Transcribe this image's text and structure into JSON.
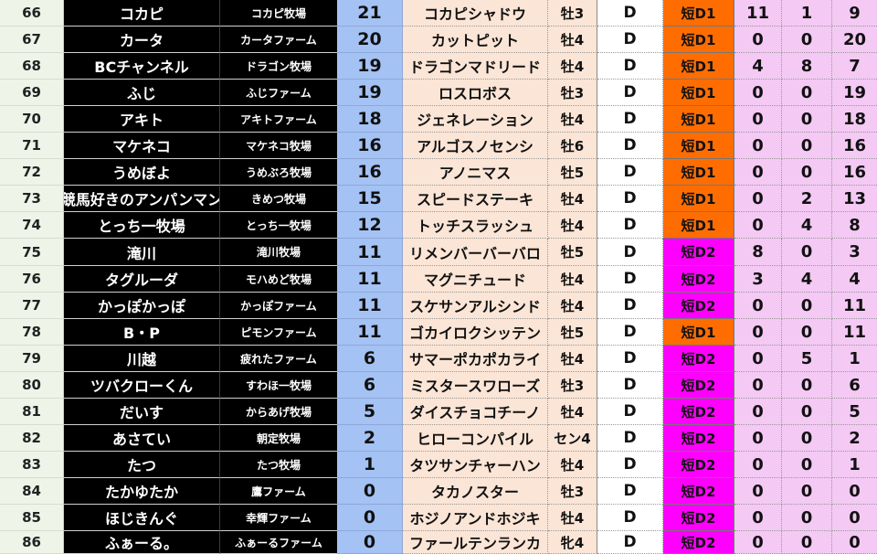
{
  "colors": {
    "row_number_bg": "#eef4e8",
    "name_bg": "#000000",
    "points_bg": "#a4c2f4",
    "horse_bg": "#fbe5d6",
    "division_d1": "#ff6d01",
    "division_d2": "#ff00ff",
    "stats_bg": "#f4c9f4"
  },
  "rows": [
    {
      "num": "66",
      "owner": "コカピ",
      "farm": "コカピ牧場",
      "points": "21",
      "horse": "コカピシャドウ",
      "sex": "牡3",
      "grade": "D",
      "division": "短D1",
      "stat1": "11",
      "stat2": "1",
      "stat3": "9"
    },
    {
      "num": "67",
      "owner": "カータ",
      "farm": "カータファーム",
      "points": "20",
      "horse": "カットピット",
      "sex": "牡4",
      "grade": "D",
      "division": "短D1",
      "stat1": "0",
      "stat2": "0",
      "stat3": "20"
    },
    {
      "num": "68",
      "owner": "BCチャンネル",
      "farm": "ドラゴン牧場",
      "points": "19",
      "horse": "ドラゴンマドリード",
      "sex": "牡4",
      "grade": "D",
      "division": "短D1",
      "stat1": "4",
      "stat2": "8",
      "stat3": "7"
    },
    {
      "num": "69",
      "owner": "ふじ",
      "farm": "ふじファーム",
      "points": "19",
      "horse": "ロスロボス",
      "sex": "牡3",
      "grade": "D",
      "division": "短D1",
      "stat1": "0",
      "stat2": "0",
      "stat3": "19"
    },
    {
      "num": "70",
      "owner": "アキト",
      "farm": "アキトファーム",
      "points": "18",
      "horse": "ジェネレーション",
      "sex": "牡4",
      "grade": "D",
      "division": "短D1",
      "stat1": "0",
      "stat2": "0",
      "stat3": "18"
    },
    {
      "num": "71",
      "owner": "マケネコ",
      "farm": "マケネコ牧場",
      "points": "16",
      "horse": "アルゴスノセンシ",
      "sex": "牡6",
      "grade": "D",
      "division": "短D1",
      "stat1": "0",
      "stat2": "0",
      "stat3": "16"
    },
    {
      "num": "72",
      "owner": "うめぼよ",
      "farm": "うめぶろ牧場",
      "points": "16",
      "horse": "アノニマス",
      "sex": "牡5",
      "grade": "D",
      "division": "短D1",
      "stat1": "0",
      "stat2": "0",
      "stat3": "16"
    },
    {
      "num": "73",
      "owner": "競馬好きのアンパンマン",
      "farm": "きめつ牧場",
      "points": "15",
      "horse": "スピードステーキ",
      "sex": "牡4",
      "grade": "D",
      "division": "短D1",
      "stat1": "0",
      "stat2": "2",
      "stat3": "13"
    },
    {
      "num": "74",
      "owner": "とっち一牧場",
      "farm": "とっち一牧場",
      "points": "12",
      "horse": "トッチスラッシュ",
      "sex": "牡4",
      "grade": "D",
      "division": "短D1",
      "stat1": "0",
      "stat2": "4",
      "stat3": "8"
    },
    {
      "num": "75",
      "owner": "滝川",
      "farm": "滝川牧場",
      "points": "11",
      "horse": "リメンバーバーバロ",
      "sex": "牡5",
      "grade": "D",
      "division": "短D2",
      "stat1": "8",
      "stat2": "0",
      "stat3": "3"
    },
    {
      "num": "76",
      "owner": "タグルーダ",
      "farm": "モハめど牧場",
      "points": "11",
      "horse": "マグニチュード",
      "sex": "牡4",
      "grade": "D",
      "division": "短D2",
      "stat1": "3",
      "stat2": "4",
      "stat3": "4"
    },
    {
      "num": "77",
      "owner": "かっぽかっぽ",
      "farm": "かっぽファーム",
      "points": "11",
      "horse": "スケサンアルシンド",
      "sex": "牡4",
      "grade": "D",
      "division": "短D2",
      "stat1": "0",
      "stat2": "0",
      "stat3": "11"
    },
    {
      "num": "78",
      "owner": "B・P",
      "farm": "ピモンファーム",
      "points": "11",
      "horse": "ゴカイロクシッテン",
      "sex": "牡5",
      "grade": "D",
      "division": "短D1",
      "stat1": "0",
      "stat2": "0",
      "stat3": "11"
    },
    {
      "num": "79",
      "owner": "川越",
      "farm": "疲れたファーム",
      "points": "6",
      "horse": "サマーポカポカライ",
      "sex": "牡4",
      "grade": "D",
      "division": "短D2",
      "stat1": "0",
      "stat2": "5",
      "stat3": "1"
    },
    {
      "num": "80",
      "owner": "ツバクローくん",
      "farm": "すわほ一牧場",
      "points": "6",
      "horse": "ミスタースワローズ",
      "sex": "牡3",
      "grade": "D",
      "division": "短D2",
      "stat1": "0",
      "stat2": "0",
      "stat3": "6"
    },
    {
      "num": "81",
      "owner": "だいす",
      "farm": "からあげ牧場",
      "points": "5",
      "horse": "ダイスチョコチーノ",
      "sex": "牡4",
      "grade": "D",
      "division": "短D2",
      "stat1": "0",
      "stat2": "0",
      "stat3": "5"
    },
    {
      "num": "82",
      "owner": "あさてい",
      "farm": "朝定牧場",
      "points": "2",
      "horse": "ヒローコンパイル",
      "sex": "セン4",
      "grade": "D",
      "division": "短D2",
      "stat1": "0",
      "stat2": "0",
      "stat3": "2"
    },
    {
      "num": "83",
      "owner": "たつ",
      "farm": "たつ牧場",
      "points": "1",
      "horse": "タツサンチャーハン",
      "sex": "牡4",
      "grade": "D",
      "division": "短D2",
      "stat1": "0",
      "stat2": "0",
      "stat3": "1"
    },
    {
      "num": "84",
      "owner": "たかゆたか",
      "farm": "鷹ファーム",
      "points": "0",
      "horse": "タカノスター",
      "sex": "牡3",
      "grade": "D",
      "division": "短D2",
      "stat1": "0",
      "stat2": "0",
      "stat3": "0"
    },
    {
      "num": "85",
      "owner": "ほじきんぐ",
      "farm": "幸輝ファーム",
      "points": "0",
      "horse": "ホジノアンドホジキ",
      "sex": "牡4",
      "grade": "D",
      "division": "短D2",
      "stat1": "0",
      "stat2": "0",
      "stat3": "0"
    },
    {
      "num": "86",
      "owner": "ふぁーる。",
      "farm": "ふぁーるファーム",
      "points": "0",
      "horse": "ファールテンランカ",
      "sex": "牝4",
      "grade": "D",
      "division": "短D2",
      "stat1": "0",
      "stat2": "0",
      "stat3": "0"
    }
  ]
}
